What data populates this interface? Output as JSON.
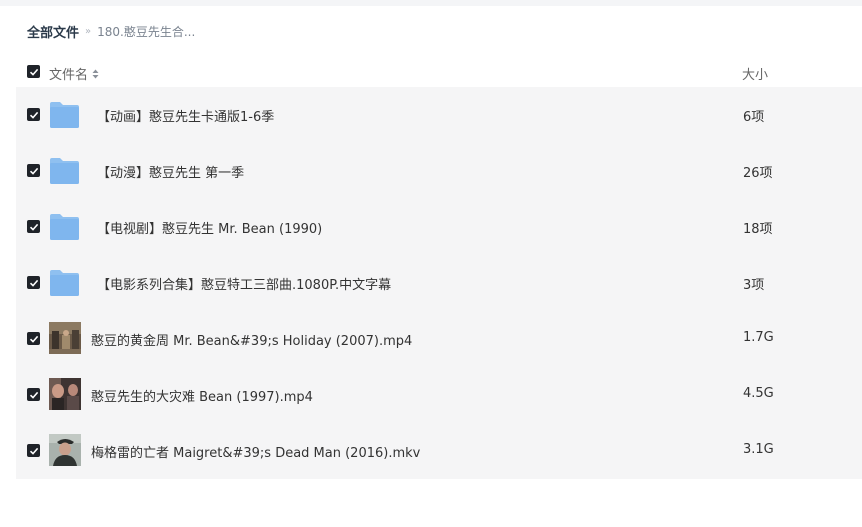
{
  "breadcrumb": {
    "root": "全部文件",
    "separator": "»",
    "current": "180.憨豆先生合..."
  },
  "columns": {
    "name": "文件名",
    "size": "大小"
  },
  "files": [
    {
      "type": "folder",
      "name": "【动画】憨豆先生卡通版1-6季",
      "size": "6项"
    },
    {
      "type": "folder",
      "name": "【动漫】憨豆先生 第一季",
      "size": "26项"
    },
    {
      "type": "folder",
      "name": "【电视剧】憨豆先生 Mr. Bean (1990)",
      "size": "18项"
    },
    {
      "type": "folder",
      "name": "【电影系列合集】憨豆特工三部曲.1080P.中文字幕",
      "size": "3项"
    },
    {
      "type": "video",
      "name": "憨豆的黄金周 Mr. Bean&#39;s Holiday (2007).mp4",
      "size": "1.7G"
    },
    {
      "type": "video",
      "name": "憨豆先生的大灾难 Bean (1997).mp4",
      "size": "4.5G"
    },
    {
      "type": "video",
      "name": "梅格雷的亡者 Maigret&#39;s Dead Man (2016).mkv",
      "size": "3.1G"
    }
  ],
  "colors": {
    "folder": "#7fb6ee",
    "checkbox": "#1f2329",
    "row_bg": "#f5f5f6"
  },
  "icons": {
    "folder": "folder-icon",
    "video": "video-thumbnail",
    "check": "check-icon",
    "sort": "sort-icon"
  }
}
